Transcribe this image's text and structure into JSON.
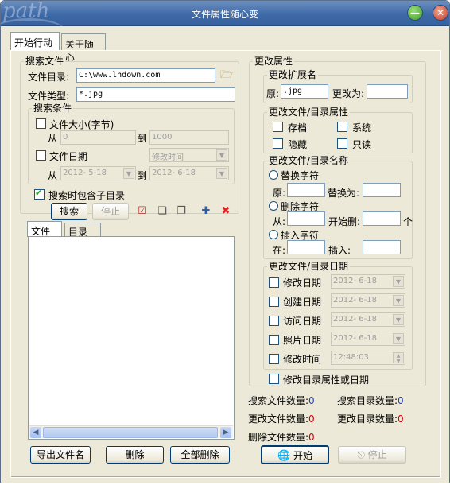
{
  "window": {
    "title": "文件属性随心变",
    "logo": "path"
  },
  "tabs": [
    "开始行动",
    "关于随心"
  ],
  "search": {
    "group_title": "搜索文件",
    "dir_label": "文件目录:",
    "dir_value": "C:\\www.lhdown.com",
    "type_label": "文件类型:",
    "type_value": "*.jpg",
    "conditions_title": "搜索条件",
    "size_label": "文件大小(字节)",
    "from_label": "从",
    "to_label": "到",
    "size_from": "0",
    "size_to": "1000",
    "date_label": "文件日期",
    "date_mode": "修改时间",
    "date_from": "2012- 5-18",
    "date_to": "2012- 6-18",
    "include_sub": "搜索时包含子目录",
    "search_btn": "搜索",
    "stop_btn": "停止"
  },
  "result_tabs": [
    "文件",
    "目录"
  ],
  "bottom_buttons": [
    "导出文件名",
    "删除",
    "全部删除"
  ],
  "change": {
    "group_title": "更改属性",
    "ext": {
      "title": "更改扩展名",
      "orig_label": "原:",
      "orig_value": ".jpg",
      "new_label": "更改为:",
      "new_value": ""
    },
    "attr": {
      "title": "更改文件/目录属性",
      "items": [
        "存档",
        "系统",
        "隐藏",
        "只读"
      ]
    },
    "name": {
      "title": "更改文件/目录名称",
      "replace": "替换字符",
      "orig_label": "原:",
      "replace_to_label": "替换为:",
      "delete": "删除字符",
      "from_label": "从:",
      "start_del_label": "开始删:",
      "unit": "个",
      "insert": "插入字符",
      "at_label": "在:",
      "insert_label": "插入:"
    },
    "date": {
      "title": "更改文件/目录日期",
      "rows": [
        {
          "label": "修改日期",
          "value": "2012- 6-18"
        },
        {
          "label": "创建日期",
          "value": "2012- 6-18"
        },
        {
          "label": "访问日期",
          "value": "2012- 6-18"
        },
        {
          "label": "照片日期",
          "value": "2012- 6-18"
        },
        {
          "label": "修改时间",
          "value": "12:48:03"
        }
      ]
    },
    "dir_attr_date": "修改目录属性或日期"
  },
  "stats": {
    "search_files_label": "搜索文件数量:",
    "search_files": "0",
    "search_dirs_label": "搜索目录数量:",
    "search_dirs": "0",
    "changed_files_label": "更改文件数量:",
    "changed_files": "0",
    "changed_dirs_label": "更改目录数量:",
    "changed_dirs": "0",
    "deleted_files_label": "删除文件数量:",
    "deleted_files": "0"
  },
  "actions": {
    "start": "开始",
    "stop": "停止"
  },
  "colors": {
    "title_bar": "#3f6aa8",
    "window_bg": "#ece9d8",
    "count_blue": "#1f3fc0",
    "count_red": "#d40000"
  }
}
